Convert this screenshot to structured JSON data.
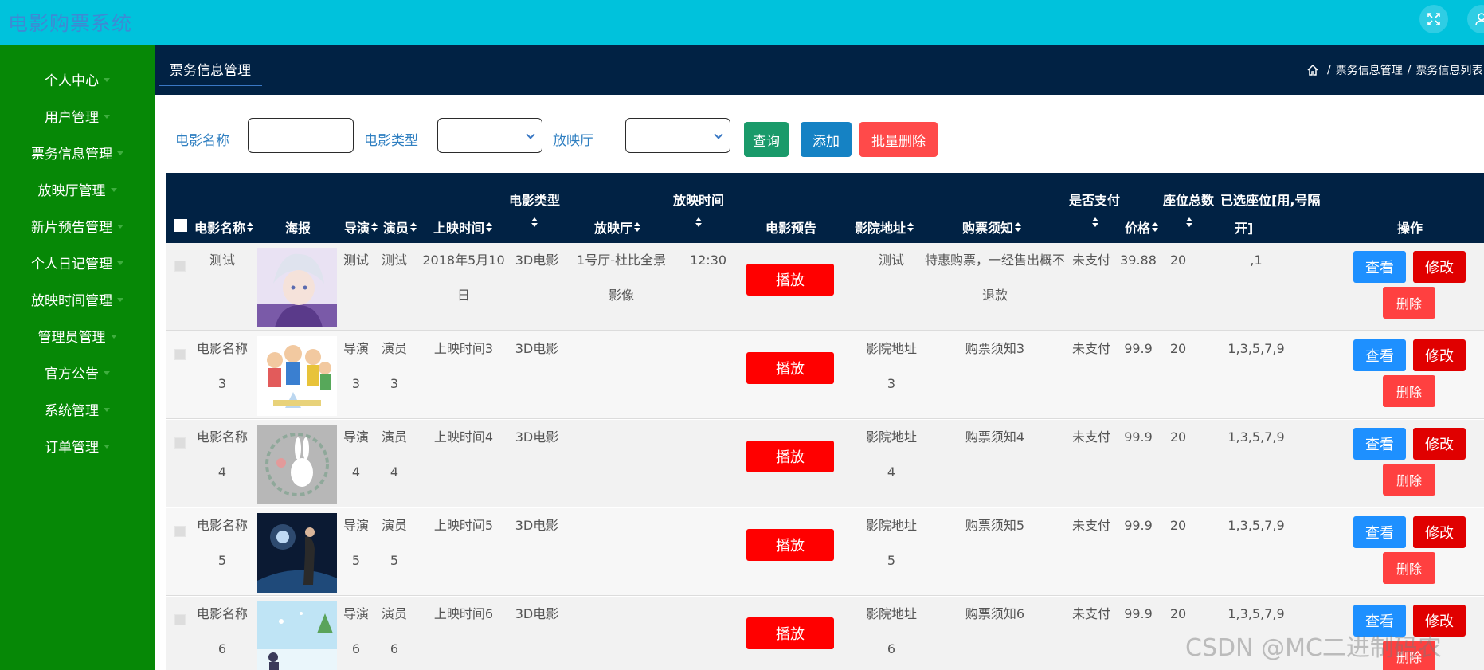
{
  "header": {
    "title": "电影购票系统"
  },
  "sidebar": {
    "items": [
      {
        "label": "个人中心"
      },
      {
        "label": "用户管理"
      },
      {
        "label": "票务信息管理"
      },
      {
        "label": "放映厅管理"
      },
      {
        "label": "新片预告管理"
      },
      {
        "label": "个人日记管理"
      },
      {
        "label": "放映时间管理"
      },
      {
        "label": "管理员管理"
      },
      {
        "label": "官方公告"
      },
      {
        "label": "系统管理"
      },
      {
        "label": "订单管理"
      }
    ]
  },
  "subheader": {
    "tab": "票务信息管理",
    "breadcrumb": [
      "票务信息管理",
      "票务信息列表"
    ]
  },
  "search": {
    "name_label": "电影名称",
    "name_value": "",
    "type_label": "电影类型",
    "type_value": "",
    "hall_label": "放映厅",
    "hall_value": "",
    "query_button": "查询",
    "add_button": "添加",
    "batch_delete_button": "批量删除"
  },
  "table": {
    "headers": {
      "name": "电影名称",
      "poster": "海报",
      "director": "导演",
      "actor": "演员",
      "release": "上映时间",
      "type": "电影类型",
      "hall": "放映厅",
      "showtime": "放映时间",
      "trailer": "电影预告",
      "address": "影院地址",
      "notice": "购票须知",
      "paid": "是否支付",
      "price": "价格",
      "seats": "座位总数",
      "selected_line1": "已选座位[用,号隔",
      "selected_line2": "开]",
      "actions": "操作"
    },
    "play_label": "播放",
    "view_label": "查看",
    "edit_label": "修改",
    "delete_label": "删除",
    "rows": [
      {
        "name_l1": "测试",
        "name_l2": "",
        "director_l1": "测试",
        "director_l2": "",
        "actor_l1": "测试",
        "actor_l2": "",
        "release_l1": "2018年5月10",
        "release_l2": "日",
        "type": "3D电影",
        "hall_l1": "1号厅-杜比全景",
        "hall_l2": "影像",
        "showtime": "12:30",
        "address_l1": "测试",
        "address_l2": "",
        "notice_l1": "特惠购票，一经售出概不",
        "notice_l2": "退款",
        "paid": "未支付",
        "price": "39.88",
        "seats": "20",
        "selected": ",1"
      },
      {
        "name_l1": "电影名称",
        "name_l2": "3",
        "director_l1": "导演",
        "director_l2": "3",
        "actor_l1": "演员",
        "actor_l2": "3",
        "release_l1": "上映时间3",
        "release_l2": "",
        "type": "3D电影",
        "hall_l1": "",
        "hall_l2": "",
        "showtime": "",
        "address_l1": "影院地址",
        "address_l2": "3",
        "notice_l1": "购票须知3",
        "notice_l2": "",
        "paid": "未支付",
        "price": "99.9",
        "seats": "20",
        "selected": "1,3,5,7,9"
      },
      {
        "name_l1": "电影名称",
        "name_l2": "4",
        "director_l1": "导演",
        "director_l2": "4",
        "actor_l1": "演员",
        "actor_l2": "4",
        "release_l1": "上映时间4",
        "release_l2": "",
        "type": "3D电影",
        "hall_l1": "",
        "hall_l2": "",
        "showtime": "",
        "address_l1": "影院地址",
        "address_l2": "4",
        "notice_l1": "购票须知4",
        "notice_l2": "",
        "paid": "未支付",
        "price": "99.9",
        "seats": "20",
        "selected": "1,3,5,7,9"
      },
      {
        "name_l1": "电影名称",
        "name_l2": "5",
        "director_l1": "导演",
        "director_l2": "5",
        "actor_l1": "演员",
        "actor_l2": "5",
        "release_l1": "上映时间5",
        "release_l2": "",
        "type": "3D电影",
        "hall_l1": "",
        "hall_l2": "",
        "showtime": "",
        "address_l1": "影院地址",
        "address_l2": "5",
        "notice_l1": "购票须知5",
        "notice_l2": "",
        "paid": "未支付",
        "price": "99.9",
        "seats": "20",
        "selected": "1,3,5,7,9"
      },
      {
        "name_l1": "电影名称",
        "name_l2": "6",
        "director_l1": "导演",
        "director_l2": "6",
        "actor_l1": "演员",
        "actor_l2": "6",
        "release_l1": "上映时间6",
        "release_l2": "",
        "type": "3D电影",
        "hall_l1": "",
        "hall_l2": "",
        "showtime": "",
        "address_l1": "影院地址",
        "address_l2": "6",
        "notice_l1": "购票须知6",
        "notice_l2": "",
        "paid": "未支付",
        "price": "99.9",
        "seats": "20",
        "selected": "1,3,5,7,9"
      }
    ]
  },
  "watermark": "CSDN @MC二进制码农",
  "colors": {
    "topbar": "#00c2dc",
    "sidebar": "#068806",
    "navy": "#012244",
    "query": "#1a9a6a",
    "add": "#1582c4",
    "batch_delete": "#ff4a4a",
    "play": "#ff0000",
    "view": "#1e90ff",
    "edit": "#e00000",
    "delete": "#ff4040"
  }
}
